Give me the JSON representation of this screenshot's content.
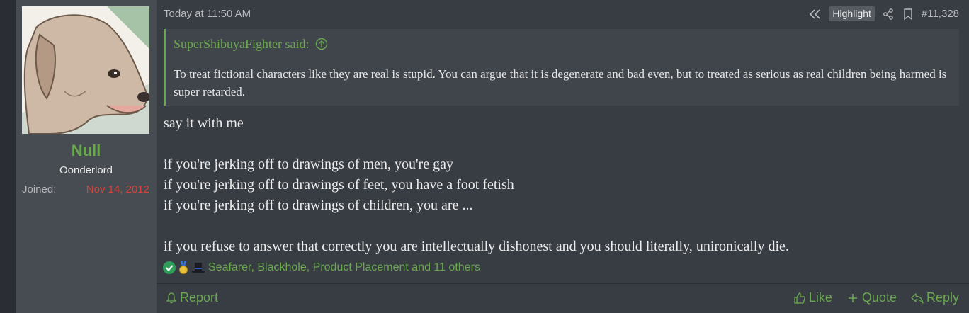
{
  "post": {
    "user": {
      "name": "Null",
      "title": "Oonderlord",
      "joined_label": "Joined:",
      "joined_date": "Nov 14, 2012",
      "avatar_icon": "dog-avatar"
    },
    "timestamp": "Today at 11:50 AM",
    "actions": {
      "highlight_label": "Highlight",
      "post_number": "#11,328"
    },
    "quote": {
      "author_line": "SuperShibuyaFighter said:",
      "text": "To treat fictional characters like they are real is stupid. You can argue that it is degenerate and bad even, but to treated as serious as real children being harmed is super retarded."
    },
    "message_lines": [
      "say it with me",
      "",
      "if you're jerking off to drawings of men, you're gay",
      "if you're jerking off to drawings of feet, you have a foot fetish",
      "if you're jerking off to drawings of children, you are ...",
      "",
      "if you refuse to answer that correctly you are intellectually dishonest and you should literally, unironically die."
    ],
    "reactions": {
      "text": "Seafarer, Blackhole, Product Placement and 11 others",
      "icons": [
        "check-icon",
        "medal-icon",
        "top-hat-icon"
      ]
    },
    "footer": {
      "report": "Report",
      "like": "Like",
      "quote": "Quote",
      "reply": "Reply"
    }
  },
  "colors": {
    "accent_green": "#6aa84f",
    "joined_red": "#d3443b",
    "post_bg": "#383c43",
    "user_col_bg": "#474b52"
  }
}
